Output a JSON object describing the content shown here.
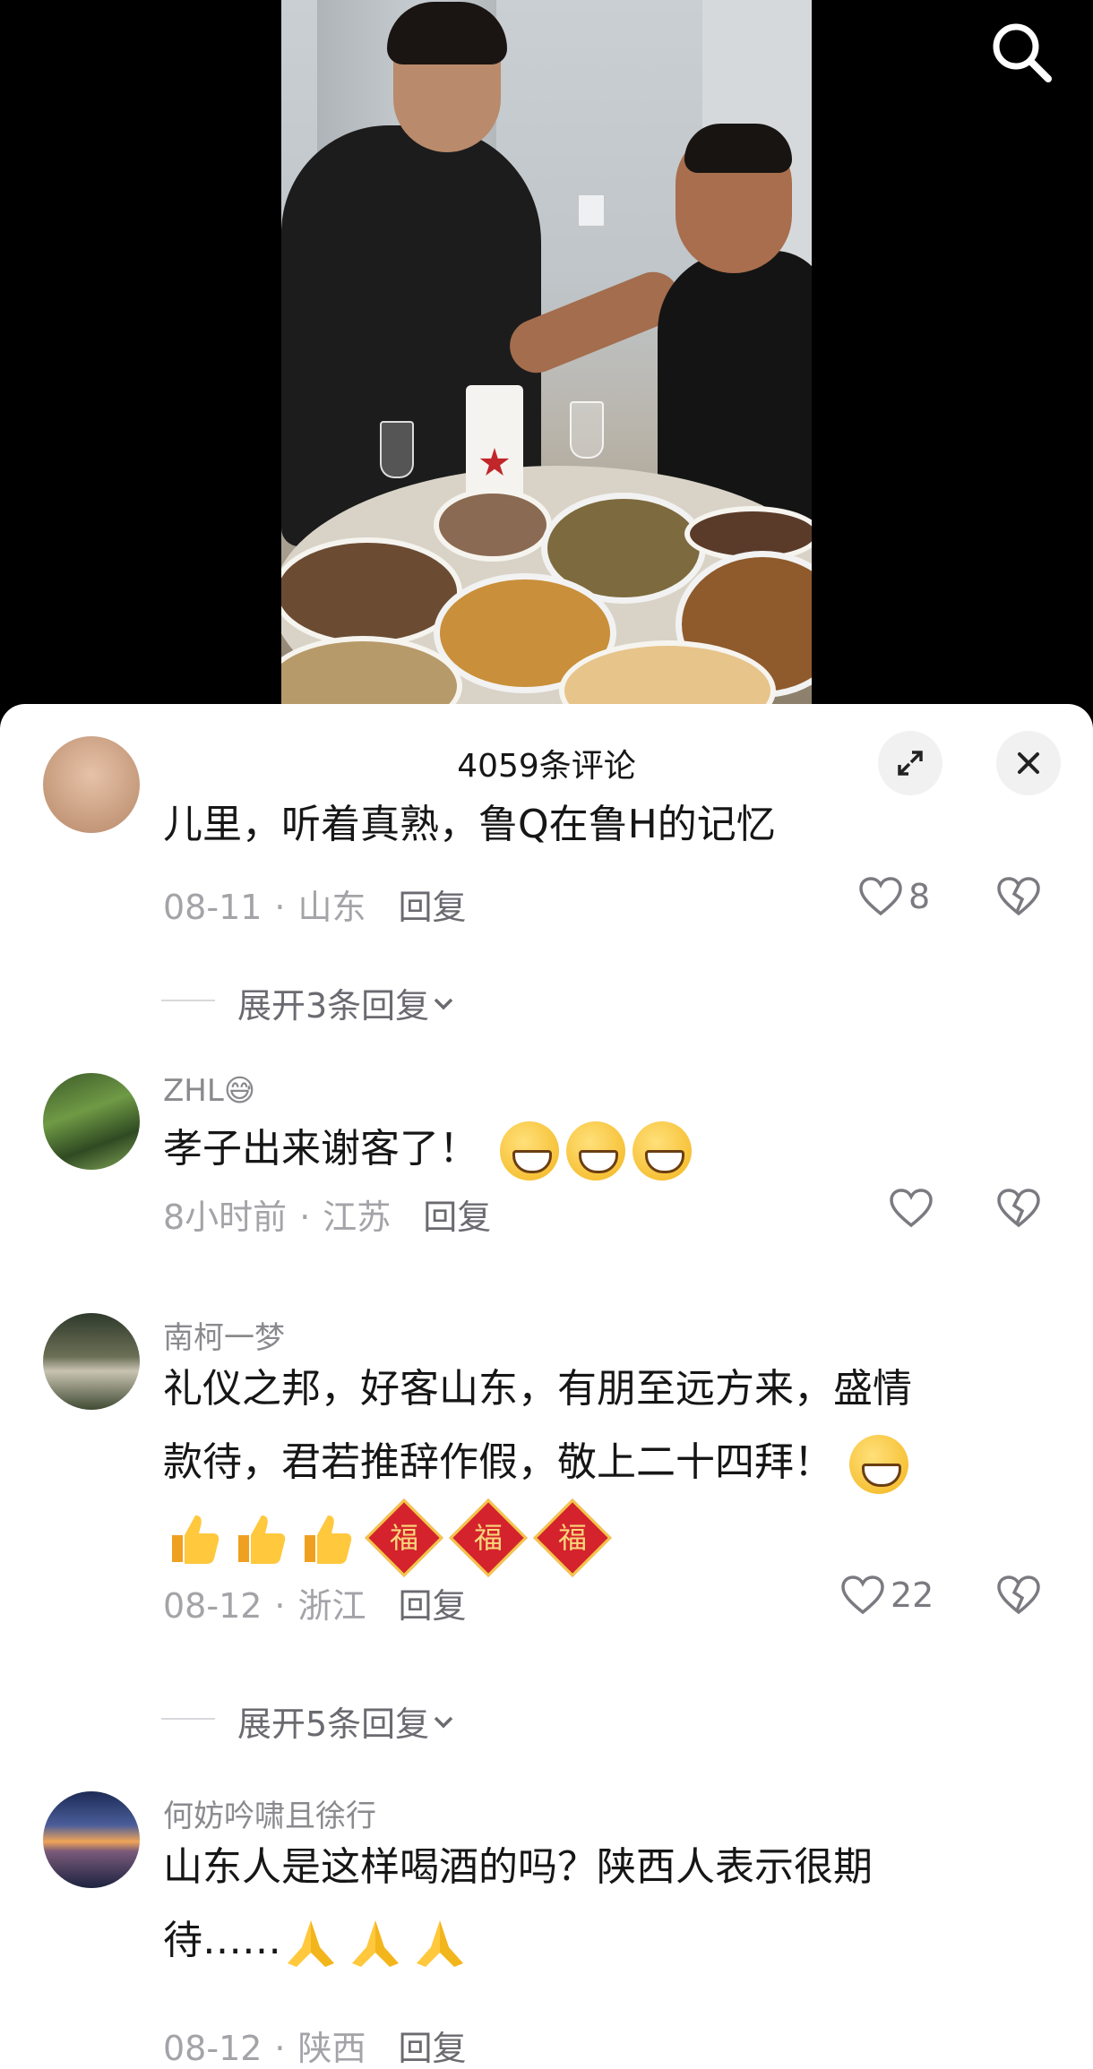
{
  "header": {
    "comment_count_title": "4059条评论"
  },
  "icons": {
    "search": "search-icon",
    "expand": "expand-icon",
    "close": "close-icon",
    "like": "heart-icon",
    "dislike": "broken-heart-icon"
  },
  "comments": [
    {
      "username": "",
      "text": "儿里，听着真熟，鲁Q在鲁H的记忆",
      "date": "08-11",
      "location": "山东",
      "reply_label": "回复",
      "likes": "8",
      "expand_replies": "展开3条回复"
    },
    {
      "username": "ZHL😅",
      "text": "孝子出来谢客了！",
      "date": "8小时前",
      "location": "江苏",
      "reply_label": "回复",
      "likes": ""
    },
    {
      "username": "南柯一梦",
      "text_line1": "礼仪之邦，好客山东，有朋至远方来，盛情",
      "text_line2": "款待，君若推辞作假，敬上二十四拜！",
      "fu_char": "福",
      "date": "08-12",
      "location": "浙江",
      "reply_label": "回复",
      "likes": "22",
      "expand_replies": "展开5条回复"
    },
    {
      "username": "何妨吟啸且徐行",
      "text_line1": "山东人是这样喝酒的吗？陕西人表示很期",
      "text_line2": "待……",
      "date": "08-12",
      "location": "陕西",
      "reply_label": "回复"
    }
  ],
  "colors": {
    "sheet_bg": "#ffffff",
    "text_primary": "#161616",
    "text_secondary": "#a3a3a8",
    "button_bg": "#f1f1f2"
  }
}
